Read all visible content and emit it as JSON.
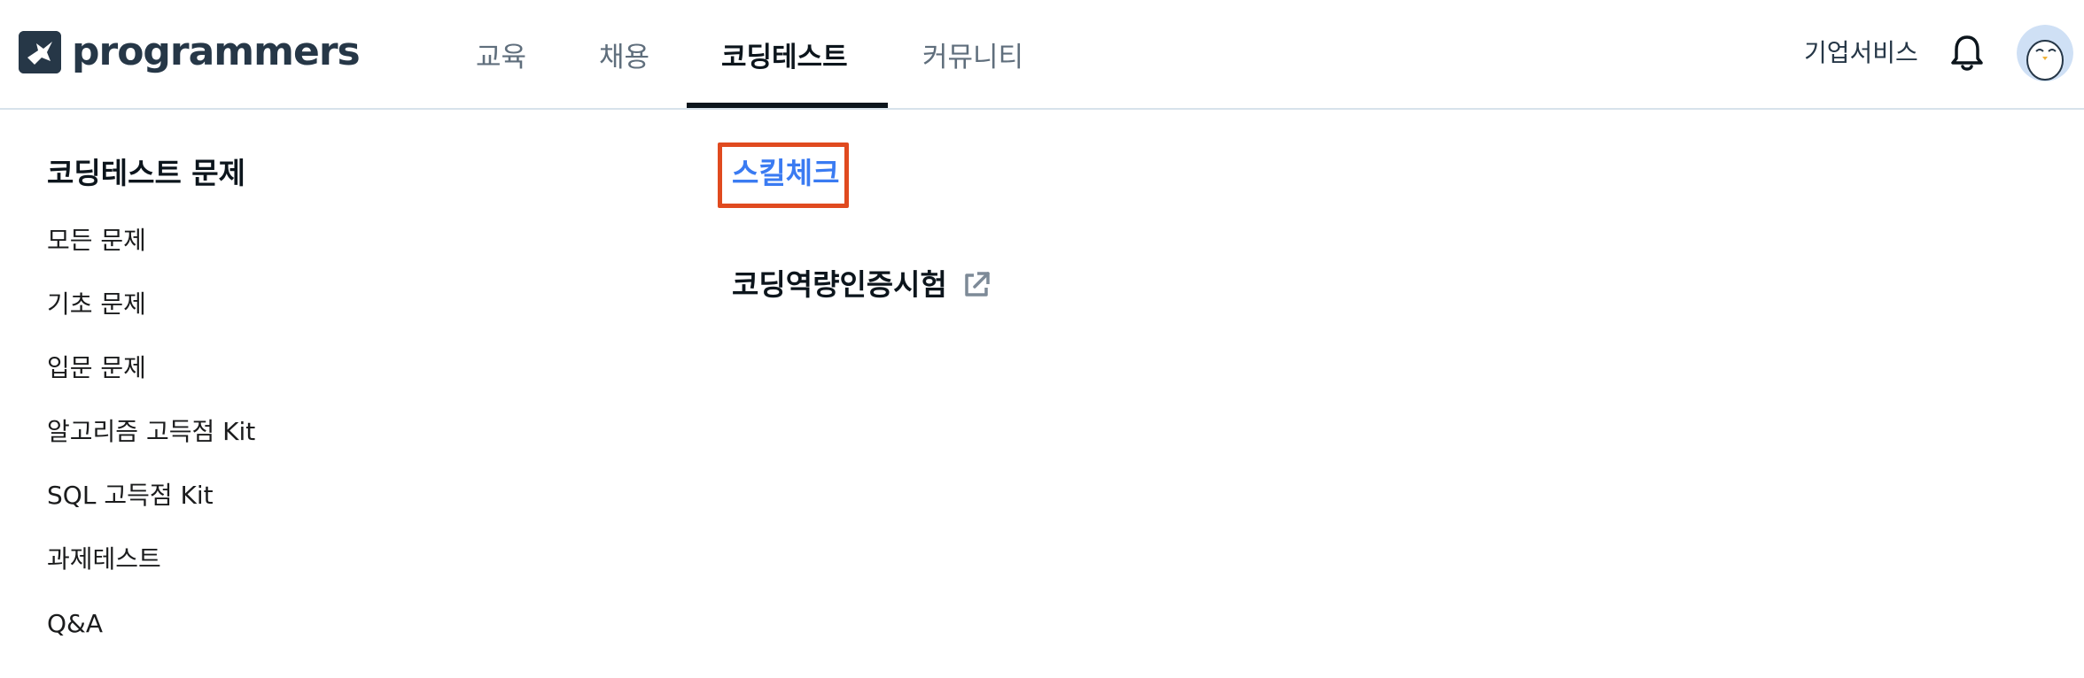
{
  "header": {
    "logo_text": "programmers",
    "nav": [
      {
        "label": "교육"
      },
      {
        "label": "채용"
      },
      {
        "label": "코딩테스트"
      },
      {
        "label": "커뮤니티"
      }
    ],
    "active_tab": "코딩테스트",
    "business_link": "기업서비스",
    "icons": {
      "notification": "bell-icon",
      "avatar": "user-avatar"
    }
  },
  "sidebar": {
    "title": "코딩테스트 문제",
    "items": [
      {
        "label": "모든 문제"
      },
      {
        "label": "기초 문제"
      },
      {
        "label": "입문 문제"
      },
      {
        "label": "알고리즘 고득점 Kit"
      },
      {
        "label": "SQL 고득점 Kit"
      },
      {
        "label": "과제테스트"
      },
      {
        "label": "Q&A"
      }
    ]
  },
  "main": {
    "skill_check": "스킬체크",
    "certification": "코딩역량인증시험",
    "certification_icon": "external-link-icon"
  },
  "colors": {
    "accent_blue": "#3a7bf2",
    "highlight_box": "#e04a1f",
    "brand_dark": "#263747",
    "border": "#d7e2eb"
  }
}
